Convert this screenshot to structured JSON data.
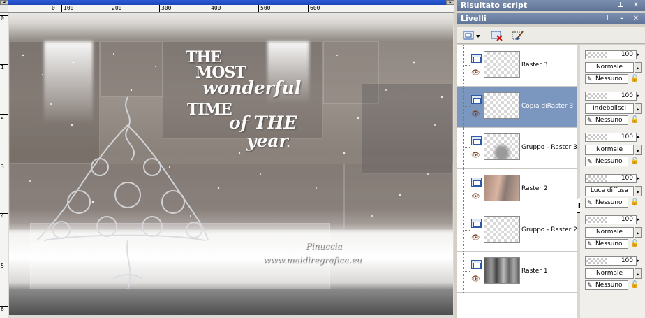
{
  "canvas": {
    "ruler_h_labels": [
      "0",
      "100",
      "200",
      "300",
      "400",
      "500",
      "600"
    ],
    "ruler_v_labels": [
      "0",
      "1",
      "2",
      "3",
      "4",
      "5",
      "6"
    ],
    "art_title": [
      "THE",
      "MOST",
      "wonderful",
      "TIME",
      "of THE",
      "year"
    ],
    "watermark": [
      "Pinuccia",
      "www.maidiregrafica.eu"
    ]
  },
  "panels": {
    "script_title": "Risultato script",
    "layers_title": "Livelli"
  },
  "layers": [
    {
      "name": "Raster 3",
      "opacity": "100",
      "blend": "Normale",
      "mask": "Nessuno",
      "selected": false,
      "thumb": "empty"
    },
    {
      "name": "Copia diRaster 3",
      "opacity": "100",
      "blend": "Indebolisci",
      "mask": "Nessuno",
      "selected": true,
      "thumb": "empty"
    },
    {
      "name": "Gruppo - Raster 3",
      "opacity": "100",
      "blend": "Normale",
      "mask": "Nessuno",
      "selected": false,
      "thumb": "tree"
    },
    {
      "name": "Raster 2",
      "opacity": "100",
      "blend": "Luce diffusa",
      "mask": "Nessuno",
      "selected": false,
      "thumb": "photo"
    },
    {
      "name": "Gruppo - Raster 2",
      "opacity": "100",
      "blend": "Normale",
      "mask": "Nessuno",
      "selected": false,
      "thumb": "empty"
    },
    {
      "name": "Raster 1",
      "opacity": "100",
      "blend": "Normale",
      "mask": "Nessuno",
      "selected": false,
      "thumb": "bg"
    }
  ],
  "colors": {
    "panel_title": "#5e7396",
    "selected_layer": "#7b97c0"
  }
}
